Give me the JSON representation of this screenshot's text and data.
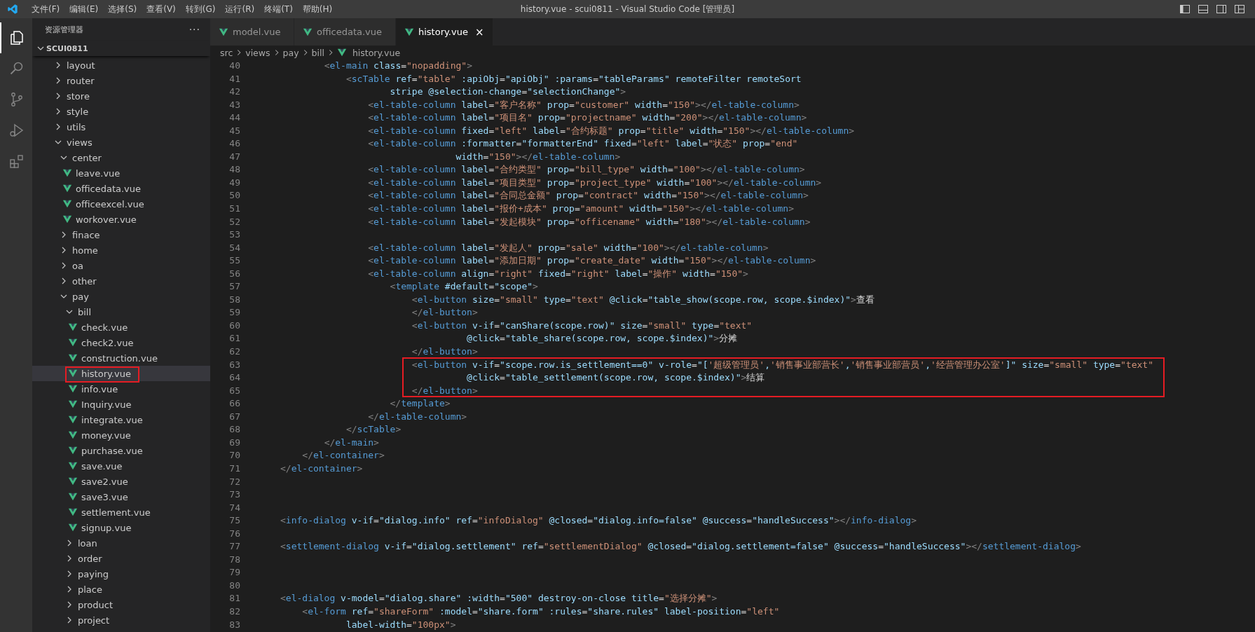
{
  "title_bar": {
    "menu": [
      "文件(F)",
      "编辑(E)",
      "选择(S)",
      "查看(V)",
      "转到(G)",
      "运行(R)",
      "终端(T)",
      "帮助(H)"
    ],
    "title": "history.vue - scui0811 - Visual Studio Code [管理员]"
  },
  "activity_bar": {
    "items": [
      {
        "selected": true
      },
      {
        "selected": false
      },
      {
        "selected": false
      },
      {
        "selected": false
      },
      {
        "selected": false
      }
    ]
  },
  "sidebar": {
    "title": "资源管理器",
    "more": "···",
    "root": {
      "label": "SCUI0811",
      "expanded": true
    },
    "tree": [
      {
        "label": "layout",
        "kind": "folder",
        "expanded": false,
        "selected": false
      },
      {
        "label": "router",
        "kind": "folder",
        "expanded": false,
        "selected": false
      },
      {
        "label": "store",
        "kind": "folder",
        "expanded": false,
        "selected": false
      },
      {
        "label": "style",
        "kind": "folder",
        "expanded": false,
        "selected": false
      },
      {
        "label": "utils",
        "kind": "folder",
        "expanded": false,
        "selected": false
      },
      {
        "label": "views",
        "kind": "folder",
        "expanded": true,
        "selected": false,
        "children": [
          {
            "label": "center",
            "kind": "folder",
            "expanded": true,
            "selected": false,
            "children": [
              {
                "label": "leave.vue",
                "kind": "file",
                "selected": false
              },
              {
                "label": "officedata.vue",
                "kind": "file",
                "selected": false
              },
              {
                "label": "officeexcel.vue",
                "kind": "file",
                "selected": false
              },
              {
                "label": "workover.vue",
                "kind": "file",
                "selected": false
              }
            ]
          },
          {
            "label": "finace",
            "kind": "folder",
            "expanded": false,
            "selected": false
          },
          {
            "label": "home",
            "kind": "folder",
            "expanded": false,
            "selected": false
          },
          {
            "label": "oa",
            "kind": "folder",
            "expanded": false,
            "selected": false
          },
          {
            "label": "other",
            "kind": "folder",
            "expanded": false,
            "selected": false
          },
          {
            "label": "pay",
            "kind": "folder",
            "expanded": true,
            "selected": false,
            "children": [
              {
                "label": "bill",
                "kind": "folder",
                "expanded": true,
                "selected": false,
                "children": [
                  {
                    "label": "check.vue",
                    "kind": "file",
                    "selected": false
                  },
                  {
                    "label": "check2.vue",
                    "kind": "file",
                    "selected": false
                  },
                  {
                    "label": "construction.vue",
                    "kind": "file",
                    "selected": false
                  },
                  {
                    "label": "history.vue",
                    "kind": "file",
                    "selected": true,
                    "boxed": true
                  },
                  {
                    "label": "info.vue",
                    "kind": "file",
                    "selected": false
                  },
                  {
                    "label": "Inquiry.vue",
                    "kind": "file",
                    "selected": false
                  },
                  {
                    "label": "integrate.vue",
                    "kind": "file",
                    "selected": false
                  },
                  {
                    "label": "money.vue",
                    "kind": "file",
                    "selected": false
                  },
                  {
                    "label": "purchase.vue",
                    "kind": "file",
                    "selected": false
                  },
                  {
                    "label": "save.vue",
                    "kind": "file",
                    "selected": false
                  },
                  {
                    "label": "save2.vue",
                    "kind": "file",
                    "selected": false
                  },
                  {
                    "label": "save3.vue",
                    "kind": "file",
                    "selected": false
                  },
                  {
                    "label": "settlement.vue",
                    "kind": "file",
                    "selected": false
                  },
                  {
                    "label": "signup.vue",
                    "kind": "file",
                    "selected": false
                  }
                ]
              },
              {
                "label": "loan",
                "kind": "folder",
                "expanded": false,
                "selected": false
              },
              {
                "label": "order",
                "kind": "folder",
                "expanded": false,
                "selected": false
              },
              {
                "label": "paying",
                "kind": "folder",
                "expanded": false,
                "selected": false
              },
              {
                "label": "place",
                "kind": "folder",
                "expanded": false,
                "selected": false
              },
              {
                "label": "product",
                "kind": "folder",
                "expanded": false,
                "selected": false
              },
              {
                "label": "project",
                "kind": "folder",
                "expanded": false,
                "selected": false
              }
            ]
          }
        ]
      }
    ]
  },
  "editor": {
    "tabs": [
      {
        "label": "model.vue",
        "selected": false
      },
      {
        "label": "officedata.vue",
        "selected": false
      },
      {
        "label": "history.vue",
        "selected": true,
        "close": "×"
      }
    ],
    "breadcrumb": [
      "src",
      "views",
      "pay",
      "bill",
      "history.vue"
    ],
    "lines": [
      {
        "number": "40",
        "text": "        <el-main class=\"nopadding\">"
      },
      {
        "number": "41",
        "text": "            <scTable ref=\"table\" :apiObj=\"apiObj\" :params=\"tableParams\" remoteFilter remoteSort"
      },
      {
        "number": "42",
        "text": "                    stripe @selection-change=\"selectionChange\">"
      },
      {
        "number": "43",
        "text": "                <el-table-column label=\"客户名称\" prop=\"customer\" width=\"150\"></el-table-column>"
      },
      {
        "number": "44",
        "text": "                <el-table-column label=\"项目名\" prop=\"projectname\" width=\"200\"></el-table-column>"
      },
      {
        "number": "45",
        "text": "                <el-table-column fixed=\"left\" label=\"合约标题\" prop=\"title\" width=\"150\"></el-table-column>"
      },
      {
        "number": "46",
        "text": "                <el-table-column :formatter=\"formatterEnd\" fixed=\"left\" label=\"状态\" prop=\"end\""
      },
      {
        "number": "47",
        "text": "                                width=\"150\"></el-table-column>"
      },
      {
        "number": "48",
        "text": "                <el-table-column label=\"合约类型\" prop=\"bill_type\" width=\"100\"></el-table-column>"
      },
      {
        "number": "49",
        "text": "                <el-table-column label=\"项目类型\" prop=\"project_type\" width=\"100\"></el-table-column>"
      },
      {
        "number": "50",
        "text": "                <el-table-column label=\"合同总金额\" prop=\"contract\" width=\"150\"></el-table-column>"
      },
      {
        "number": "51",
        "text": "                <el-table-column label=\"报价+成本\" prop=\"amount\" width=\"150\"></el-table-column>"
      },
      {
        "number": "52",
        "text": "                <el-table-column label=\"发起模块\" prop=\"officename\" width=\"180\"></el-table-column>"
      },
      {
        "number": "53"
      },
      {
        "number": "54",
        "text": "                <el-table-column label=\"发起人\" prop=\"sale\" width=\"100\"></el-table-column>"
      },
      {
        "number": "55",
        "text": "                <el-table-column label=\"添加日期\" prop=\"create_date\" width=\"150\"></el-table-column>"
      },
      {
        "number": "56",
        "text": "                <el-table-column align=\"right\" fixed=\"right\" label=\"操作\" width=\"150\">"
      },
      {
        "number": "57",
        "text": "                    <template #default=\"scope\">"
      },
      {
        "number": "58",
        "text": "                        <el-button size=\"small\" type=\"text\" @click=\"table_show(scope.row, scope.$index)\">查看"
      },
      {
        "number": "59",
        "text": "                        </el-button>"
      },
      {
        "number": "60",
        "text": "                        <el-button v-if=\"canShare(scope.row)\" size=\"small\" type=\"text\""
      },
      {
        "number": "61",
        "text": "                                  @click=\"table_share(scope.row, scope.$index)\">分摊"
      },
      {
        "number": "62",
        "text": "                        </el-button>"
      },
      {
        "number": "63",
        "text": "                        <el-button v-if=\"scope.row.is_settlement==0\" v-role=\"['超级管理员','销售事业部营长','销售事业部营员','经营管理办公室']\" size=\"small\" type=\"text\"",
        "boxed": true
      },
      {
        "number": "64",
        "text": "                                  @click=\"table_settlement(scope.row, scope.$index)\">结算",
        "boxed": true
      },
      {
        "number": "65",
        "text": "                        </el-button>",
        "boxed": true
      },
      {
        "number": "66",
        "text": "                    </template>"
      },
      {
        "number": "67",
        "text": "                </el-table-column>"
      },
      {
        "number": "68",
        "text": "            </scTable>"
      },
      {
        "number": "69",
        "text": "        </el-main>"
      },
      {
        "number": "70",
        "text": "    </el-container>"
      },
      {
        "number": "71",
        "text": "</el-container>"
      },
      {
        "number": "72"
      },
      {
        "number": "73"
      },
      {
        "number": "74"
      },
      {
        "number": "75",
        "text": "<info-dialog v-if=\"dialog.info\" ref=\"infoDialog\" @closed=\"dialog.info=false\" @success=\"handleSuccess\"></info-dialog>"
      },
      {
        "number": "76"
      },
      {
        "number": "77",
        "text": "<settlement-dialog v-if=\"dialog.settlement\" ref=\"settlementDialog\" @closed=\"dialog.settlement=false\" @success=\"handleSuccess\"></settlement-dialog>"
      },
      {
        "number": "78"
      },
      {
        "number": "79"
      },
      {
        "number": "80"
      },
      {
        "number": "81",
        "text": "<el-dialog v-model=\"dialog.share\" :width=\"500\" destroy-on-close title=\"选择分摊\">"
      },
      {
        "number": "82",
        "text": "    <el-form ref=\"shareForm\" :model=\"share.form\" :rules=\"share.rules\" label-position=\"left\""
      },
      {
        "number": "83",
        "text": "            label-width=\"100px\">"
      }
    ]
  }
}
